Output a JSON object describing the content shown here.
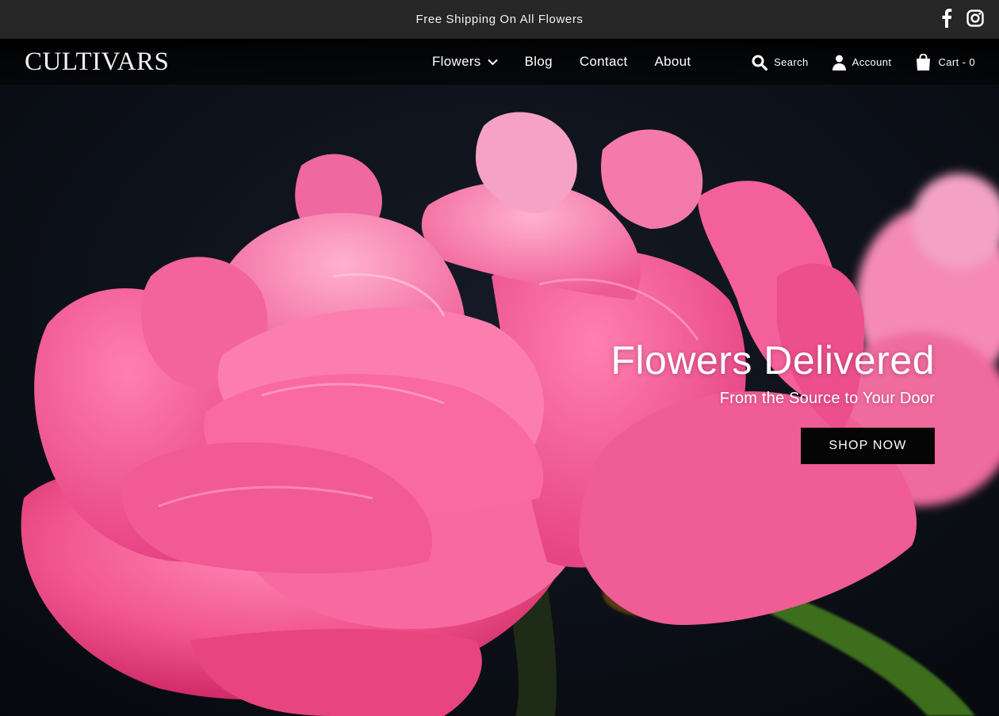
{
  "announcement": {
    "text": "Free Shipping On All Flowers"
  },
  "social": {
    "facebook_icon": "facebook-icon",
    "instagram_icon": "instagram-icon"
  },
  "header": {
    "logo": "CULTIVARS",
    "nav": [
      {
        "label": "Flowers",
        "has_dropdown": true
      },
      {
        "label": "Blog"
      },
      {
        "label": "Contact"
      },
      {
        "label": "About"
      }
    ],
    "utilities": {
      "search": "Search",
      "account": "Account",
      "cart": "Cart - 0"
    }
  },
  "hero": {
    "title": "Flowers Delivered",
    "subtitle": "From the Source to Your Door",
    "cta": "SHOP NOW"
  },
  "colors": {
    "announcement_bg": "#262626",
    "hero_bg": "#0a0d14",
    "petal_pink": "#f2578f",
    "button_bg": "#050505"
  }
}
